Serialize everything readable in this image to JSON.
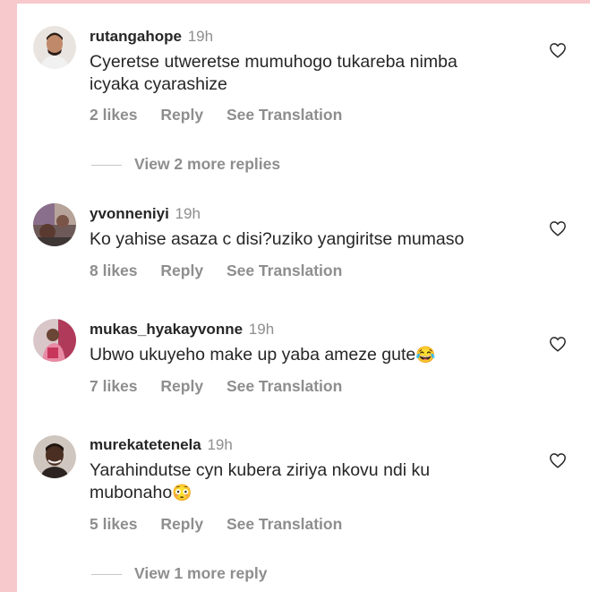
{
  "comments": [
    {
      "username": "rutangahope",
      "time": "19h",
      "text": "Cyeretse utweretse mumuhogo tukareba nimba icyaka cyarashize",
      "likes": "2 likes",
      "reply": "Reply",
      "translate": "See Translation",
      "more_replies": "View 2 more replies"
    },
    {
      "username": "yvonneniyi",
      "time": "19h",
      "text": "Ko yahise asaza c disi?uziko yangiritse mumaso",
      "likes": "8 likes",
      "reply": "Reply",
      "translate": "See Translation"
    },
    {
      "username": "mukas_hyakayvonne",
      "time": "19h",
      "text": "Ubwo ukuyeho make up yaba ameze gute",
      "emoji": "😂",
      "likes": "7 likes",
      "reply": "Reply",
      "translate": "See Translation"
    },
    {
      "username": "murekatetenela",
      "time": "19h",
      "text": "Yarahindutse cyn kubera ziriya nkovu ndi ku mubonaho",
      "emoji": "😳",
      "likes": "5 likes",
      "reply": "Reply",
      "translate": "See Translation",
      "more_replies": "View 1 more reply"
    }
  ],
  "icons": {
    "like": "heart-outline-icon"
  },
  "colors": {
    "primary_text": "#262626",
    "secondary_text": "#8e8e8e",
    "frame": "#f7c9cc"
  }
}
